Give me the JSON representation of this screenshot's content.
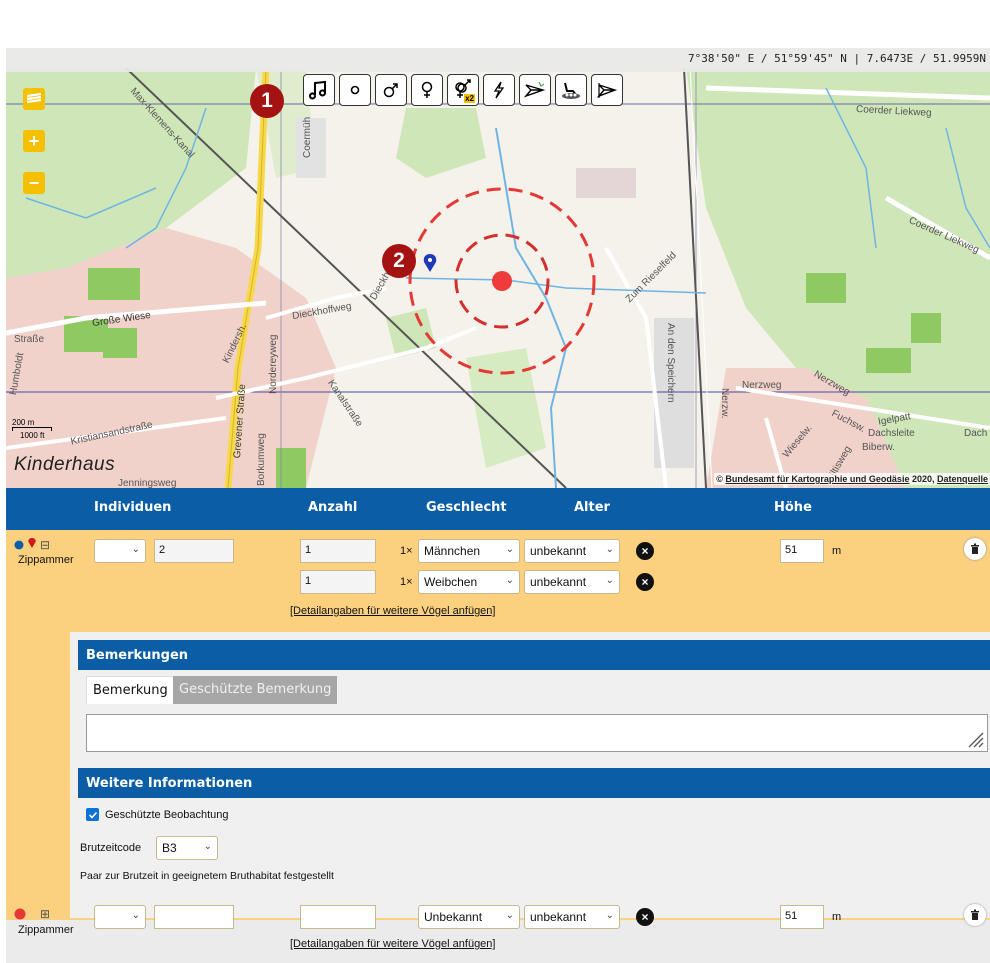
{
  "map": {
    "coordinates": "7°38'50\" E / 51°59'45\" N | 7.6473E / 51.9959N",
    "zoom_in_symbol": "+",
    "zoom_out_symbol": "−",
    "place_name": "Kinderhaus",
    "scale_m": "200 m",
    "scale_ft": "1000 ft",
    "attribution_prefix": "© ",
    "attribution_link": "Bundesamt für Kartographie und Geodäsie",
    "attribution_year": " 2020, ",
    "attribution_source": "Datenquelle",
    "street_labels": [
      "Max-Klemens-Kanal",
      "Coermüh",
      "Coerder Liekweg",
      "Dieckhoffweg",
      "Zum Rieselfeld",
      "Große Wiese",
      "Kindersh.",
      "Nordereyweg",
      "Grevener Straße",
      "Kanalstraße",
      "Borkumweg",
      "Kristiansandstraße",
      "An den Speichern",
      "Nerzweg",
      "Nerzw.",
      "Wieselw.",
      "Fuchsw.",
      "Igelpatt",
      "Dachsleite",
      "Biberw.",
      "Iltisweg",
      "Jenningsweg",
      "Straße",
      "Humboldt",
      "Dach"
    ],
    "badge_1": "1",
    "badge_2": "2",
    "tools": [
      "note-icon",
      "circle-icon",
      "male-icon",
      "female-icon",
      "pair-x2-icon",
      "lightning-icon",
      "flying-bird-icon",
      "nest-icon",
      "flag-bird-icon"
    ],
    "tool_x2_label": "x2",
    "colors": {
      "accent": "#f5c000",
      "badge": "#a51212",
      "marker": "#e53935",
      "header": "#0b5ea6",
      "row": "#fbd180"
    }
  },
  "table": {
    "headers": {
      "individuen": "Individuen",
      "anzahl": "Anzahl",
      "geschlecht": "Geschlecht",
      "alter": "Alter",
      "hoehe": "Höhe"
    }
  },
  "row1": {
    "species": "Zippammer",
    "expand_symbol": "⊟",
    "individuals_value": "2",
    "counts": [
      "1",
      "1"
    ],
    "multiplier": "1×",
    "sexes": [
      "Männchen",
      "Weibchen"
    ],
    "ages": [
      "unbekannt",
      "unbekannt"
    ],
    "remove_symbol": "×",
    "height_value": "51",
    "height_unit": "m",
    "details_link": "[Detailangaben für weitere Vögel anfügen]"
  },
  "panel": {
    "remarks_title": "Bemerkungen",
    "tab_remark": "Bemerkung",
    "tab_protected_remark": "Geschützte Bemerkung",
    "info_title": "Weitere Informationen",
    "protected_label": "Geschützte Beobachtung",
    "protected_checked": true,
    "breeding_code_label": "Brutzeitcode",
    "breeding_code_value": "B3",
    "breeding_code_desc": "Paar zur Brutzeit in geeignetem Bruthabitat festgestellt"
  },
  "row2": {
    "species": "Zippammer",
    "expand_symbol": "⊞",
    "sex": "Unbekannt",
    "age": "unbekannt",
    "remove_symbol": "×",
    "height_value": "51",
    "height_unit": "m",
    "details_link": "[Detailangaben für weitere Vögel anfügen]"
  }
}
